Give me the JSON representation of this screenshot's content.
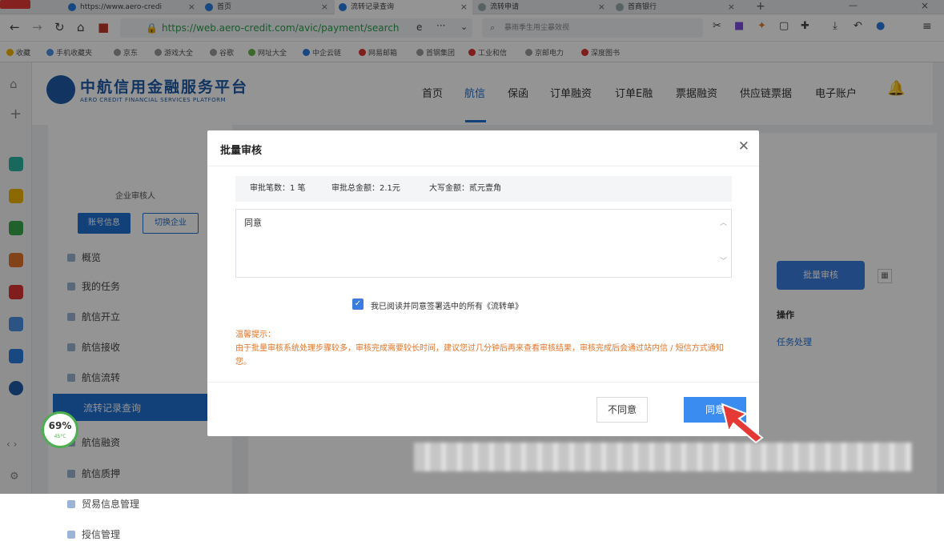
{
  "browser": {
    "tabs": [
      {
        "label": "https://www.aero-credi"
      },
      {
        "label": "首页"
      },
      {
        "label": "流转记录查询"
      },
      {
        "label": "流转申请"
      },
      {
        "label": "首商银行"
      }
    ],
    "url": "https://web.aero-credit.com/avic/payment/search",
    "search_placeholder": "暴雨季生用尘暴效视",
    "bookmarks": [
      "收藏",
      "手机收藏夹",
      "京东",
      "游戏大全",
      "谷歌",
      "网址大全",
      "中企云链",
      "网易邮箱",
      "首钢集团",
      "工业和信",
      "京邮电力",
      "深度图书"
    ]
  },
  "header": {
    "logo_cn": "中航信用金融服务平台",
    "logo_en": "AERO CREDIT FINANCIAL SERVICES PLATFORM",
    "nav": [
      "首页",
      "航信",
      "保函",
      "订单融资",
      "订单E融",
      "票据融资",
      "供应链票据",
      "电子账户"
    ]
  },
  "sidebar": {
    "role": "企业审核人",
    "account_btn": "账号信息",
    "switch_btn": "切换企业",
    "items": [
      "概览",
      "我的任务",
      "航信开立",
      "航信接收",
      "航信流转",
      "流转记录查询",
      "航信融资",
      "航信质押",
      "贸易信息管理",
      "授信管理"
    ]
  },
  "content": {
    "batch_btn": "批量审核",
    "col_action": "操作",
    "row_action": "任务处理"
  },
  "modal": {
    "title": "批量审核",
    "count_label": "审批笔数：1 笔",
    "amount_label": "审批总金额：2.1元",
    "caps_label": "大写金额：贰元壹角",
    "opinion": "同意",
    "agree_text": "我已阅读并同意签署选中的所有《流转单》",
    "tip_title": "温馨提示：",
    "tip_body": "由于批量审核系统处理步骤较多，审核完成需要较长时间，建议您过几分钟后再来查看审核结果，审核完成后会通过站内信 / 短信方式通知您。",
    "btn_disagree": "不同意",
    "btn_agree": "同意"
  },
  "widget": {
    "percent": "69%",
    "temp": "45°C"
  },
  "colors": {
    "primary": "#1f6fd1",
    "warn": "#e0742b",
    "pointer": "#e53935"
  }
}
